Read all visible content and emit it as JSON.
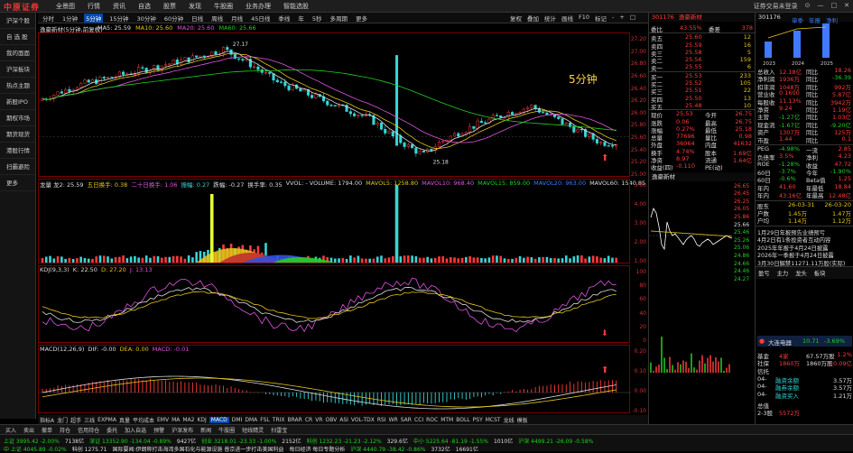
{
  "app": {
    "logo": "中原证券",
    "menu": [
      "全景图",
      "行情",
      "资讯",
      "自选",
      "股票",
      "发现",
      "牛股圈",
      "业务办理",
      "智能选股"
    ],
    "window_controls": [
      "证券交易未登录",
      "⊙",
      "—",
      "□",
      "✕"
    ]
  },
  "left_nav": [
    "沪深个股",
    "自 选 股",
    "我的面面",
    "沪深板块",
    "热点主题",
    "新股IPO",
    "期权市场",
    "期货现货",
    "港股行情",
    "扫霸避险",
    "更多"
  ],
  "period_tabs": [
    "分时",
    "1分钟",
    "5分钟",
    "15分钟",
    "30分钟",
    "60分钟",
    "日线",
    "周线",
    "月线",
    "45日线",
    "季线",
    "年",
    "5秒",
    "多周期",
    "更多"
  ],
  "period_active": "5分钟",
  "right_tools": [
    "复权",
    "叠加",
    "统计",
    "画线",
    "F10",
    "标记",
    "-",
    "+",
    "□"
  ],
  "chart": {
    "title": "逸豪新材(5分钟,前复权)",
    "ma_legend": [
      {
        "t": "MA5: 25.59",
        "c": "#ddd"
      },
      {
        "t": "MA10: 25.60",
        "c": "#e6c619"
      },
      {
        "t": "MA20: 25.60",
        "c": "#e055e0"
      },
      {
        "t": "MA60: 25.66",
        "c": "#22d022"
      }
    ],
    "period_label": "5分钟",
    "high_label": "27.17",
    "low_label": "25.18",
    "price_ticks": [
      "27.20",
      "27.00",
      "26.80",
      "26.60",
      "26.40",
      "26.20",
      "26.00",
      "25.80",
      "25.60",
      "25.40",
      "25.20",
      "25.00"
    ]
  },
  "volume": {
    "legend": [
      {
        "t": "龙量 龙2: 25.59",
        "c": "#ddd"
      },
      {
        "t": "五日换手: 0.38",
        "c": "#e6c619"
      },
      {
        "t": "二十日换手: 1.06",
        "c": "#e055e0"
      },
      {
        "t": "振幅: 0.27",
        "c": "#36d6d6"
      },
      {
        "t": "跌幅: -0.27",
        "c": "#ddd"
      },
      {
        "t": "换手率: 0.35",
        "c": "#ddd"
      },
      {
        "t": "VVOL: - VOLUME: 1794.00",
        "c": "#ddd"
      },
      {
        "t": "MAVOL5: 1258.80",
        "c": "#e6c619"
      },
      {
        "t": "MAVOL10: 968.40",
        "c": "#e055e0"
      },
      {
        "t": "MAVOL15: 859.00",
        "c": "#22d022"
      },
      {
        "t": "MAVOL20: 963.00",
        "c": "#3f7aff"
      },
      {
        "t": "MAVOL60: 1540.85",
        "c": "#ddd"
      },
      {
        "t": "V2",
        "c": "#ddd"
      }
    ],
    "ticks": [
      "5.00",
      "4.00",
      "3.00",
      "2.00",
      "1.00"
    ]
  },
  "kdj": {
    "legend": [
      {
        "t": "KDJ(9,3,3)",
        "c": "#ddd"
      },
      {
        "t": "K: 22.50",
        "c": "#ddd"
      },
      {
        "t": "D: 27.20",
        "c": "#e6c619"
      },
      {
        "t": "J: 13.13",
        "c": "#e055e0"
      }
    ],
    "ticks": [
      "100",
      "80",
      "60",
      "40",
      "20",
      "0"
    ]
  },
  "macd": {
    "legend": [
      {
        "t": "MACD(12,26,9)",
        "c": "#ddd"
      },
      {
        "t": "DIF: -0.00",
        "c": "#ddd"
      },
      {
        "t": "DEA: 0.00",
        "c": "#e6c619"
      },
      {
        "t": "MACD: -0.01",
        "c": "#e055e0"
      }
    ],
    "ticks": [
      "0.20",
      "0.10",
      "0.00",
      "-0.10"
    ]
  },
  "bottom_tabs": [
    "指标A",
    "龙门",
    "超手",
    "三线",
    "EXPMA",
    "真量",
    "平均成本",
    "EMV",
    "MA",
    "MA2",
    "KDJ",
    "MACD",
    "DMI",
    "DMA",
    "FSL",
    "TRIX",
    "BRAR",
    "CR",
    "VR",
    "OBV",
    "ASI",
    "VOL-TDX",
    "RSI",
    "WR",
    "SAR",
    "CCI",
    "ROC",
    "MTM",
    "BOLL",
    "PSY",
    "MCST",
    "龙线",
    "模板"
  ],
  "bottom_tab_active": "MACD",
  "toolbar2": [
    "买入",
    "卖出",
    "撤单",
    "持仓",
    "信用持仓",
    "委托",
    "加入自选",
    "预警",
    "沪深发布",
    "新闻",
    "牛股圈",
    "短线精灵",
    "扫雷宝"
  ],
  "ticker": {
    "code": "301176",
    "name": "逸豪新材",
    "weibi_label": "委比",
    "weibi_val": "43.55%",
    "weicha_label": "委差",
    "weicha_val": "378",
    "asks": [
      {
        "l": "卖五",
        "p": "25.60",
        "v": "12"
      },
      {
        "l": "卖四",
        "p": "25.59",
        "v": "16"
      },
      {
        "l": "卖三",
        "p": "25.58",
        "v": "5"
      },
      {
        "l": "卖二",
        "p": "25.56",
        "v": "159"
      },
      {
        "l": "卖一",
        "p": "25.55",
        "v": "6"
      }
    ],
    "bids": [
      {
        "l": "买一",
        "p": "25.53",
        "v": "233"
      },
      {
        "l": "买二",
        "p": "25.52",
        "v": "105"
      },
      {
        "l": "买三",
        "p": "25.51",
        "v": "22"
      },
      {
        "l": "买四",
        "p": "25.50",
        "v": "13"
      },
      {
        "l": "买五",
        "p": "25.48",
        "v": "10"
      }
    ],
    "stats": [
      {
        "a": "现价",
        "b": "25.53",
        "c": "今开",
        "d": "26.75"
      },
      {
        "a": "涨跌",
        "b": "0.06",
        "c": "最高",
        "d": "26.75"
      },
      {
        "a": "涨幅",
        "b": "0.27%",
        "c": "最低",
        "d": "25.18"
      },
      {
        "a": "总量",
        "b": "77696",
        "c": "量比",
        "d": "0.98"
      },
      {
        "a": "外盘",
        "b": "36064",
        "c": "内盘",
        "d": "41632"
      },
      {
        "a": "换手",
        "b": "4.74%",
        "c": "股本",
        "d": "1.69亿"
      },
      {
        "a": "净资",
        "b": "8.97",
        "c": "流通",
        "d": "1.64亿"
      },
      {
        "a": "收益(四)",
        "b": "-0.110",
        "c": "PE(动)",
        "d": ""
      }
    ]
  },
  "intraday": {
    "name": "逸豪新材",
    "ticks": [
      "26.65",
      "26.45",
      "26.25",
      "26.05",
      "25.86",
      "25.66",
      "25.46",
      "25.26",
      "25.06",
      "24.86",
      "24.66",
      "24.46",
      "24.27"
    ]
  },
  "fundamental": {
    "code": "301176",
    "tabs": [
      "单季",
      "年报",
      "净利"
    ],
    "years": [
      "2023",
      "2024",
      "2025"
    ],
    "rows": [
      {
        "a": "总收入",
        "b": "12.18亿",
        "c": "同比",
        "d": "18.26"
      },
      {
        "a": "净利润",
        "b": "1936万",
        "c": "同比",
        "d": "-36.39"
      },
      {
        "a": "扣非润",
        "b": "1048万",
        "c": "同比",
        "d": "992万"
      },
      {
        "a": "营业收",
        "b": "0.1600",
        "c": "同比",
        "d": "5.87亿"
      },
      {
        "a": "每股收",
        "b": "11.13%",
        "c": "同比",
        "d": "3942万"
      },
      {
        "a": "净资",
        "b": "9.24",
        "c": "同比",
        "d": "1.19亿"
      },
      {
        "a": "主营",
        "b": "-1.27亿",
        "c": "同比",
        "d": "1.03亿"
      },
      {
        "a": "现金流",
        "b": "-1.67亿",
        "c": "同比",
        "d": "-9.20亿"
      },
      {
        "a": "资产",
        "b": "1307万",
        "c": "同比",
        "d": "125万"
      },
      {
        "a": "市盈",
        "b": "1.44",
        "c": "同比",
        "d": "0.1"
      }
    ],
    "mid": [
      {
        "a": "PEG",
        "b": "-4.98%",
        "c": "一流",
        "d": "2.85"
      },
      {
        "a": "负债率",
        "b": "3.5%",
        "c": "净利",
        "d": "4.23"
      },
      {
        "a": "ROE",
        "b": "-1.28%",
        "c": "收益",
        "d": "47.72"
      },
      {
        "a": "60日",
        "b": "-3.7%",
        "c": "今年",
        "d": "-1.90%"
      },
      {
        "a": "60日",
        "b": "-0.6%",
        "c": "Beta值",
        "d": "1.25"
      },
      {
        "a": "年内",
        "b": "41.60",
        "c": "年最低",
        "d": "18.84"
      },
      {
        "a": "年内",
        "b": "43.16亿",
        "c": "年最高",
        "d": "12.48亿"
      }
    ],
    "dates": [
      {
        "a": "股东",
        "b": "26-03-31",
        "c": "26-03-20"
      },
      {
        "a": "户数",
        "b": "1.45万",
        "c": "1.47万"
      },
      {
        "a": "户均",
        "b": "1.14万",
        "c": "1.12万"
      }
    ],
    "news": [
      "1月29日年报预告业绩预亏",
      "4月2日有1条投资者互动内容",
      "2025年年报于4月24日披露",
      "2026年一季报于4月24日披露",
      "3月30日解禁11271.11万股(实际)"
    ],
    "news_tabs": [
      "盈亏",
      "主力",
      "龙头",
      "板块"
    ],
    "fund": [
      {
        "a": "基金",
        "b": "4家",
        "c": "67.57万股",
        "d": "1.2%"
      },
      {
        "a": "社保",
        "b": "1860万",
        "c": "1860万股",
        "d": "10.09亿"
      },
      {
        "a": "信托",
        "b": "",
        "c": "",
        "d": ""
      }
    ],
    "sector_label": "大连电器",
    "sector_val": "10.71",
    "sector_chg": "-3.69%",
    "sector_rows": [
      {
        "a": "04-",
        "b": "融资余额",
        "c": "3.57万"
      },
      {
        "a": "04-",
        "b": "融券余额",
        "c": "3.57万"
      },
      {
        "a": "04-",
        "b": "融资买入",
        "c": "1.21万"
      }
    ],
    "bottom": [
      {
        "a": "总值",
        "b": "",
        "c": ""
      },
      {
        "a": "2-3股",
        "b": "5572万",
        "c": ""
      }
    ]
  },
  "status": {
    "row1": [
      "上证 3995.42 -2.00%",
      "7138亿",
      "深证 13352.90 -134.04 -0.89%",
      "9427亿",
      "创业 3218.01 -23.33 -1.00%",
      "2152亿",
      "科创 1232.23 -21.23 -2.12%",
      "329.6亿",
      "中小 5225.64 -81.19 -1.55%",
      "1010亿",
      "沪深 4499.21 -26.09 -0.58%"
    ],
    "row2": [
      "中 上证 4045.89 -0.02%",
      "科创 1275.71",
      "国际要闻:伊朗称打击海湾多国石化与能源设施 普京进一步打击美国利益",
      "每日经济 每日专题分析",
      "沪深 4440.79 -38.42 -0.86%",
      "3732亿",
      "16691亿"
    ]
  }
}
